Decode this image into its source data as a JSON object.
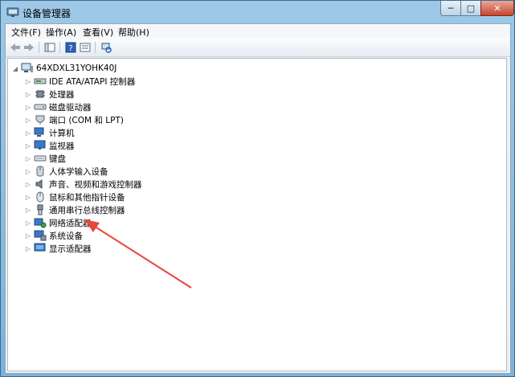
{
  "window": {
    "title": "设备管理器",
    "caption_min": "─",
    "caption_max": "□",
    "caption_close": "✕"
  },
  "menu": [
    "文件(F)",
    "操作(A)",
    "查看(V)",
    "帮助(H)"
  ],
  "tree": {
    "root": "64XDXL31YOHK40J",
    "items": [
      {
        "label": "IDE ATA/ATAPI 控制器",
        "icon": "ide-controller-icon"
      },
      {
        "label": "处理器",
        "icon": "processor-icon"
      },
      {
        "label": "磁盘驱动器",
        "icon": "disk-drive-icon"
      },
      {
        "label": "端口 (COM 和 LPT)",
        "icon": "port-icon"
      },
      {
        "label": "计算机",
        "icon": "computer-icon"
      },
      {
        "label": "监视器",
        "icon": "monitor-icon"
      },
      {
        "label": "键盘",
        "icon": "keyboard-icon"
      },
      {
        "label": "人体学输入设备",
        "icon": "hid-icon"
      },
      {
        "label": "声音、视频和游戏控制器",
        "icon": "sound-icon"
      },
      {
        "label": "鼠标和其他指针设备",
        "icon": "mouse-icon"
      },
      {
        "label": "通用串行总线控制器",
        "icon": "usb-icon"
      },
      {
        "label": "网络适配器",
        "icon": "network-adapter-icon"
      },
      {
        "label": "系统设备",
        "icon": "system-device-icon"
      },
      {
        "label": "显示适配器",
        "icon": "display-adapter-icon"
      }
    ]
  },
  "colors": {
    "annotation_arrow": "#e8453c"
  }
}
